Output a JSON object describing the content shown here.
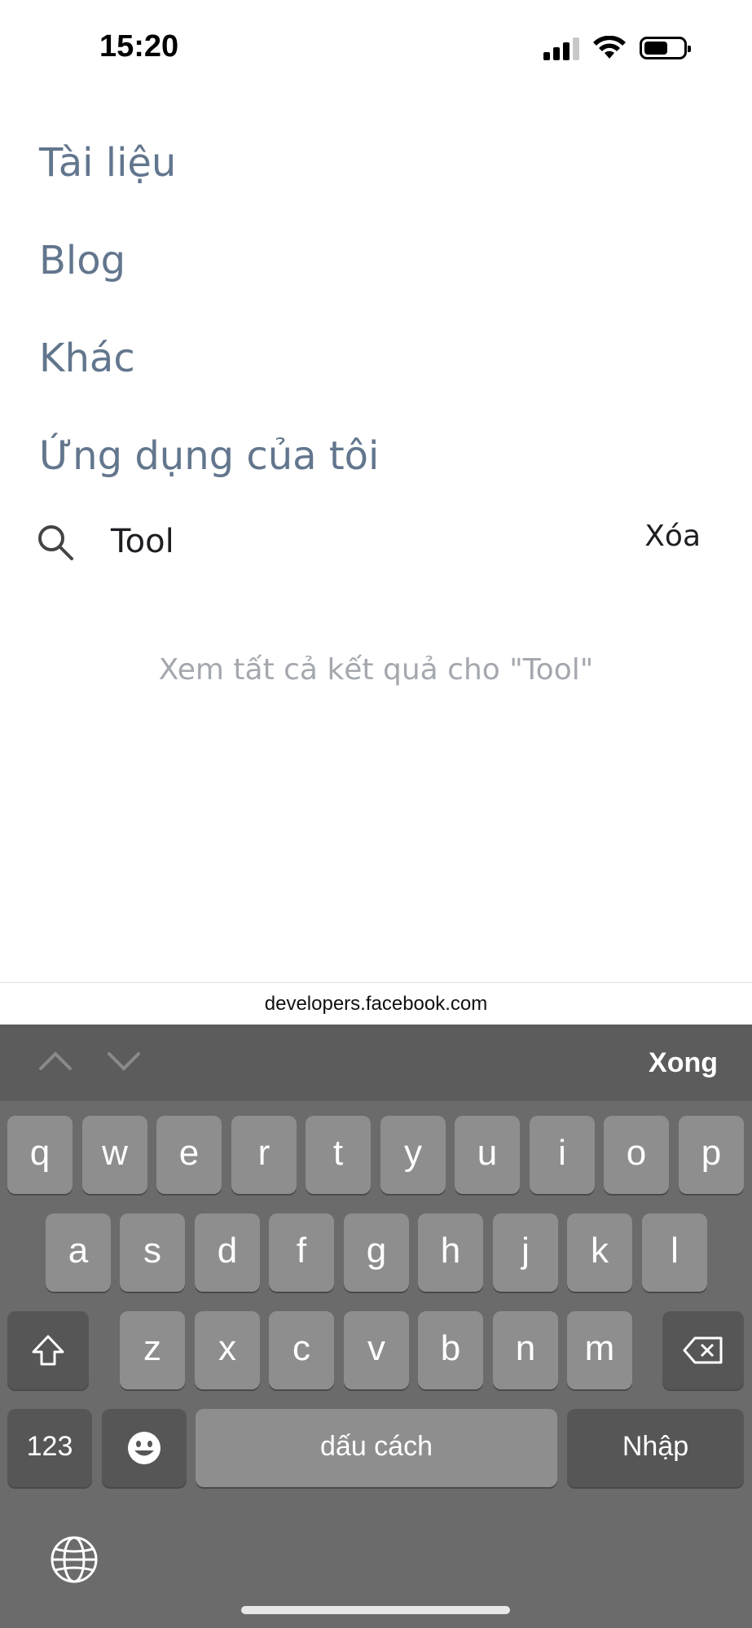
{
  "status_bar": {
    "time": "15:20"
  },
  "nav": {
    "items": [
      "Tài liệu",
      "Blog",
      "Khác",
      "Ứng dụng của tôi"
    ]
  },
  "search": {
    "value": "Tool",
    "clear_label": "Xóa"
  },
  "results": {
    "see_all": "Xem tất cả kết quả cho \"Tool\""
  },
  "browser": {
    "url": "developers.facebook.com"
  },
  "keyboard": {
    "done_label": "Xong",
    "row1": [
      "q",
      "w",
      "e",
      "r",
      "t",
      "y",
      "u",
      "i",
      "o",
      "p"
    ],
    "row2": [
      "a",
      "s",
      "d",
      "f",
      "g",
      "h",
      "j",
      "k",
      "l"
    ],
    "row3": [
      "z",
      "x",
      "c",
      "v",
      "b",
      "n",
      "m"
    ],
    "numbers_label": "123",
    "space_label": "dấu cách",
    "return_label": "Nhập"
  },
  "icons": [
    "search-icon",
    "wifi-icon",
    "battery-icon",
    "cellular-signal-icon",
    "chevron-up-icon",
    "chevron-down-icon",
    "shift-icon",
    "backspace-icon",
    "emoji-icon",
    "globe-icon"
  ]
}
